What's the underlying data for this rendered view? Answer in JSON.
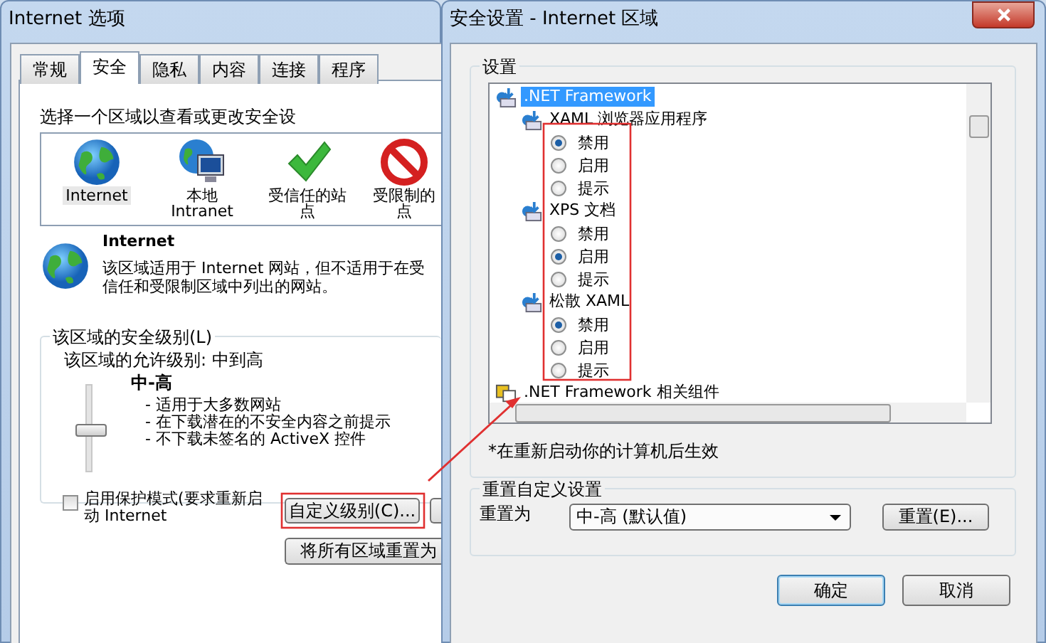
{
  "options_window": {
    "title": "Internet 选项",
    "tabs": [
      {
        "label": "常规",
        "selected": false
      },
      {
        "label": "安全",
        "selected": true
      },
      {
        "label": "隐私",
        "selected": false
      },
      {
        "label": "内容",
        "selected": false
      },
      {
        "label": "连接",
        "selected": false
      },
      {
        "label": "程序",
        "selected": false
      }
    ],
    "zone_prompt": "选择一个区域以查看或更改安全设",
    "zones": [
      {
        "kind": "globe",
        "label_lines": [
          "Internet"
        ],
        "selected": true
      },
      {
        "kind": "intranet",
        "label_lines": [
          "本地",
          "Intranet"
        ],
        "selected": false
      },
      {
        "kind": "check",
        "label_lines": [
          "受信任的站",
          "点"
        ],
        "selected": false
      },
      {
        "kind": "forbidden",
        "label_lines": [
          "受限制的",
          "点"
        ],
        "selected": false
      }
    ],
    "zone_title": "Internet",
    "zone_description": "该区域适用于 Internet 网站，但不适用于在受信任和受限制区域中列出的网站。",
    "level_group": {
      "title": "该区域的安全级别(L)",
      "allowed": "该区域的允许级别: 中到高",
      "level": 0.5,
      "level_name": "中-高",
      "bullets": [
        "- 适用于大多数网站",
        "- 在下载潜在的不安全内容之前提示",
        "- 不下载未签名的 ActiveX 控件"
      ],
      "protected_mode": {
        "label": "启用保护模式(要求重新启动 Internet",
        "checked": false
      },
      "custom_button": "自定义级别(C)..."
    },
    "reset_all_button": "将所有区域重置为"
  },
  "settings_dialog": {
    "title": "安全设置 - Internet 区域",
    "settings_label": "设置",
    "tree": [
      {
        "label": ".NET Framework",
        "selected": true,
        "children": [
          {
            "label": "XAML 浏览器应用程序",
            "options": [
              {
                "label": "禁用",
                "selected": true
              },
              {
                "label": "启用",
                "selected": false
              },
              {
                "label": "提示",
                "selected": false
              }
            ]
          },
          {
            "label": "XPS 文档",
            "options": [
              {
                "label": "禁用",
                "selected": false
              },
              {
                "label": "启用",
                "selected": true
              },
              {
                "label": "提示",
                "selected": false
              }
            ]
          },
          {
            "label": "松散 XAML",
            "options": [
              {
                "label": "禁用",
                "selected": true
              },
              {
                "label": "启用",
                "selected": false
              },
              {
                "label": "提示",
                "selected": false
              }
            ]
          }
        ]
      },
      {
        "label": ".NET Framework 相关组件",
        "selected": false
      }
    ],
    "note": "*在重新启动你的计算机后生效",
    "reset_group": {
      "title": "重置自定义设置",
      "reset_to_label": "重置为",
      "reset_to_value": "中-高 (默认值)",
      "reset_button": "重置(E)..."
    },
    "buttons": [
      "确定",
      "取消"
    ]
  }
}
